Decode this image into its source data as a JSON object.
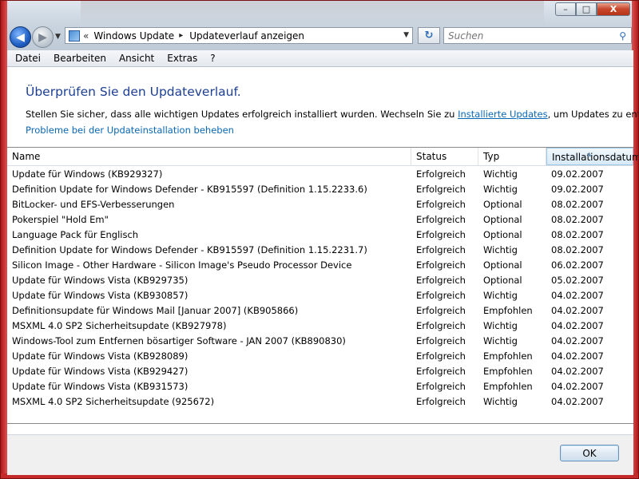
{
  "window": {
    "controls": {
      "minimize": "–",
      "maximize": "□",
      "close": "X"
    }
  },
  "nav": {
    "back_icon": "arrow-left-icon",
    "forward_icon": "arrow-right-icon",
    "chevron": "«",
    "breadcrumb": [
      "Windows Update",
      "Updateverlauf anzeigen"
    ],
    "refresh_glyph": "↻"
  },
  "search": {
    "placeholder": "Suchen"
  },
  "menu": [
    "Datei",
    "Bearbeiten",
    "Ansicht",
    "Extras",
    "?"
  ],
  "page": {
    "heading": "Überprüfen Sie den Updateverlauf.",
    "description_before": "Stellen Sie sicher, dass alle wichtigen Updates erfolgreich installiert wurden. Wechseln Sie zu ",
    "description_link": "Installierte Updates",
    "description_after": ", um Updates zu entfernen.",
    "trouble_link": "Probleme bei der Updateinstallation beheben"
  },
  "table": {
    "columns": [
      "Name",
      "Status",
      "Typ",
      "Installationsdatum"
    ],
    "sorted_column": "Installationsdatum",
    "rows": [
      [
        "Update für Windows (KB929327)",
        "Erfolgreich",
        "Wichtig",
        "09.02.2007"
      ],
      [
        "Definition Update for Windows Defender - KB915597 (Definition 1.15.2233.6)",
        "Erfolgreich",
        "Wichtig",
        "09.02.2007"
      ],
      [
        "BitLocker- und EFS-Verbesserungen",
        "Erfolgreich",
        "Optional",
        "08.02.2007"
      ],
      [
        "Pokerspiel \"Hold Em\"",
        "Erfolgreich",
        "Optional",
        "08.02.2007"
      ],
      [
        "Language Pack für Englisch",
        "Erfolgreich",
        "Optional",
        "08.02.2007"
      ],
      [
        "Definition Update for Windows Defender - KB915597 (Definition 1.15.2231.7)",
        "Erfolgreich",
        "Wichtig",
        "08.02.2007"
      ],
      [
        "Silicon Image - Other Hardware - Silicon Image's Pseudo Processor Device",
        "Erfolgreich",
        "Optional",
        "06.02.2007"
      ],
      [
        "Update für Windows Vista (KB929735)",
        "Erfolgreich",
        "Optional",
        "05.02.2007"
      ],
      [
        "Update für Windows Vista (KB930857)",
        "Erfolgreich",
        "Wichtig",
        "04.02.2007"
      ],
      [
        "Definitionsupdate für Windows Mail [Januar 2007] (KB905866)",
        "Erfolgreich",
        "Empfohlen",
        "04.02.2007"
      ],
      [
        "MSXML 4.0 SP2 Sicherheitsupdate  (KB927978)",
        "Erfolgreich",
        "Wichtig",
        "04.02.2007"
      ],
      [
        "Windows-Tool zum Entfernen bösartiger Software - JAN 2007 (KB890830)",
        "Erfolgreich",
        "Wichtig",
        "04.02.2007"
      ],
      [
        "Update für Windows Vista (KB928089)",
        "Erfolgreich",
        "Empfohlen",
        "04.02.2007"
      ],
      [
        "Update für Windows Vista (KB929427)",
        "Erfolgreich",
        "Empfohlen",
        "04.02.2007"
      ],
      [
        "Update für Windows Vista (KB931573)",
        "Erfolgreich",
        "Empfohlen",
        "04.02.2007"
      ],
      [
        "MSXML 4.0 SP2 Sicherheitsupdate  (925672)",
        "Erfolgreich",
        "Wichtig",
        "04.02.2007"
      ]
    ]
  },
  "footer": {
    "ok_label": "OK"
  },
  "colors": {
    "heading": "#1c3f94",
    "link": "#0a67b5",
    "frame_accent": "#c42a2a"
  }
}
